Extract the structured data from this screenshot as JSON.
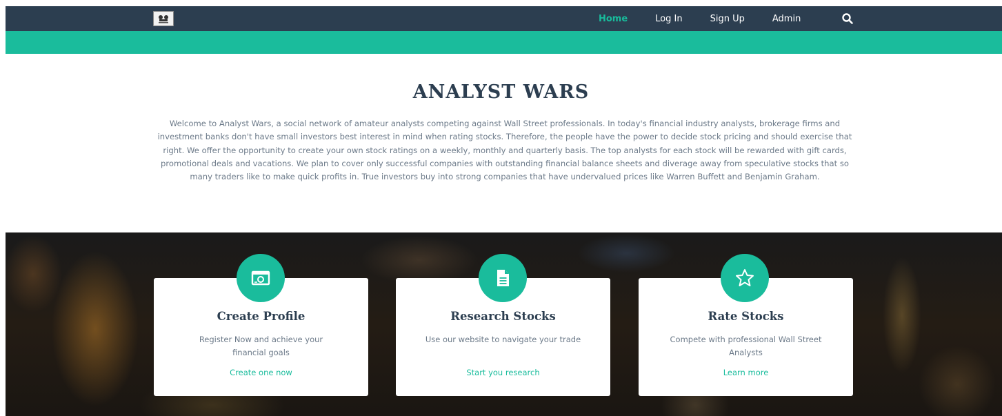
{
  "nav": {
    "logo_icon": "analyst-wars-logo",
    "links": [
      {
        "label": "Home",
        "active": true
      },
      {
        "label": "Log In",
        "active": false
      },
      {
        "label": "Sign Up",
        "active": false
      },
      {
        "label": "Admin",
        "active": false
      }
    ],
    "search_icon": "search-icon"
  },
  "intro": {
    "title": "ANALYST WARS",
    "text": "Welcome to Analyst Wars, a social network of amateur analysts competing against Wall Street professionals. In today's financial industry analysts, brokerage firms and investment banks don't have small investors best interest in mind when rating stocks. Therefore, the people have the power to decide stock pricing and should exercise that right. We offer the opportunity to create your own stock ratings on a weekly, monthly and quarterly basis. The top analysts for each stock will be rewarded with gift cards, promotional deals and vacations. We plan to cover only successful companies with outstanding financial balance sheets and diverage away from speculative stocks that so many traders like to make quick profits in. True investors buy into strong companies that have undervalued prices like Warren Buffett and Benjamin Graham."
  },
  "features": [
    {
      "icon": "profile-card-icon",
      "title": "Create Profile",
      "description": "Register Now and achieve your financial goals",
      "link": "Create one now"
    },
    {
      "icon": "document-icon",
      "title": "Research Stocks",
      "description": "Use our website to navigate your trade",
      "link": "Start you research"
    },
    {
      "icon": "star-icon",
      "title": "Rate Stocks",
      "description": "Compete with professional Wall Street Analysts",
      "link": "Learn more"
    }
  ],
  "colors": {
    "navbar": "#2c3e50",
    "accent": "#1abc9c",
    "heading": "#2c3e50",
    "body_text": "#6c7a89"
  }
}
